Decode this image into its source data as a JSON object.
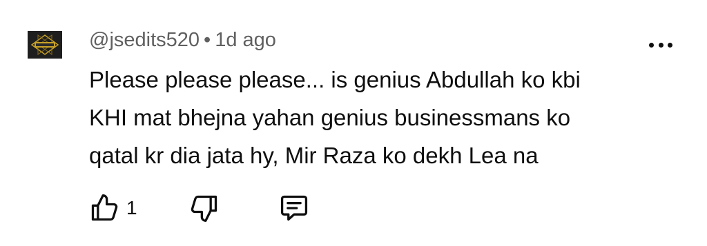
{
  "comment": {
    "avatar": {
      "icon": "channel-avatar-logo"
    },
    "author": "@jsedits520",
    "separator": "•",
    "timestamp": "1d ago",
    "text_lines": [
      "Please please please... is genius Abdullah ko kbi",
      "KHI mat bhejna yahan genius businessmans ko",
      "qatal kr dia jata hy, Mir Raza ko dekh Lea na"
    ],
    "actions": {
      "like_icon": "thumbs-up-icon",
      "like_count": "1",
      "dislike_icon": "thumbs-down-icon",
      "reply_icon": "reply-comment-icon",
      "menu_icon": "more-vertical-icon"
    }
  },
  "colors": {
    "text": "#0f0f0f",
    "meta": "#606060",
    "avatar_bg": "#1e1e1e",
    "avatar_accent": "#c9a227"
  }
}
